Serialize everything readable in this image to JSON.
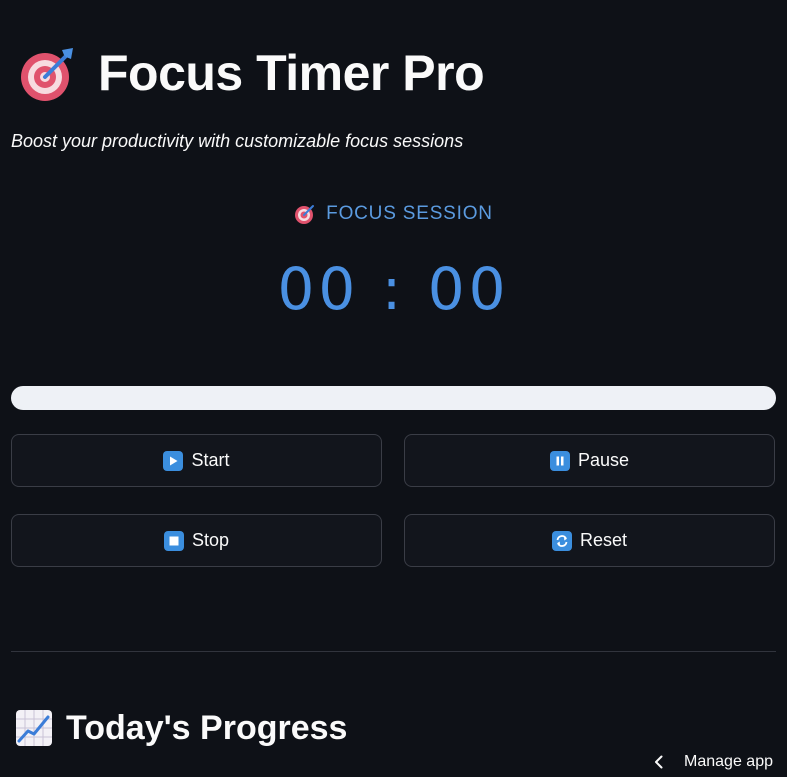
{
  "header": {
    "title": "Focus Timer Pro",
    "title_icon": "direct-hit-target-icon",
    "subtitle": "Boost your productivity with customizable focus sessions"
  },
  "session": {
    "label": "FOCUS SESSION",
    "icon": "direct-hit-target-icon",
    "time": "00 : 00",
    "progress_fraction": 0
  },
  "controls": {
    "start_label": "Start",
    "start_icon": "play-button-icon",
    "pause_label": "Pause",
    "pause_icon": "pause-button-icon",
    "stop_label": "Stop",
    "stop_icon": "stop-button-icon",
    "reset_label": "Reset",
    "reset_icon": "refresh-arrows-icon"
  },
  "progress_section": {
    "title": "Today's Progress",
    "icon": "chart-increasing-icon"
  },
  "footer": {
    "manage_label": "Manage app",
    "manage_icon": "chevron-left-icon"
  },
  "colors": {
    "background": "#0e1117",
    "accent": "#4a90e2",
    "button_icon": "#3b8ede",
    "progress_track": "#eef1f6"
  }
}
